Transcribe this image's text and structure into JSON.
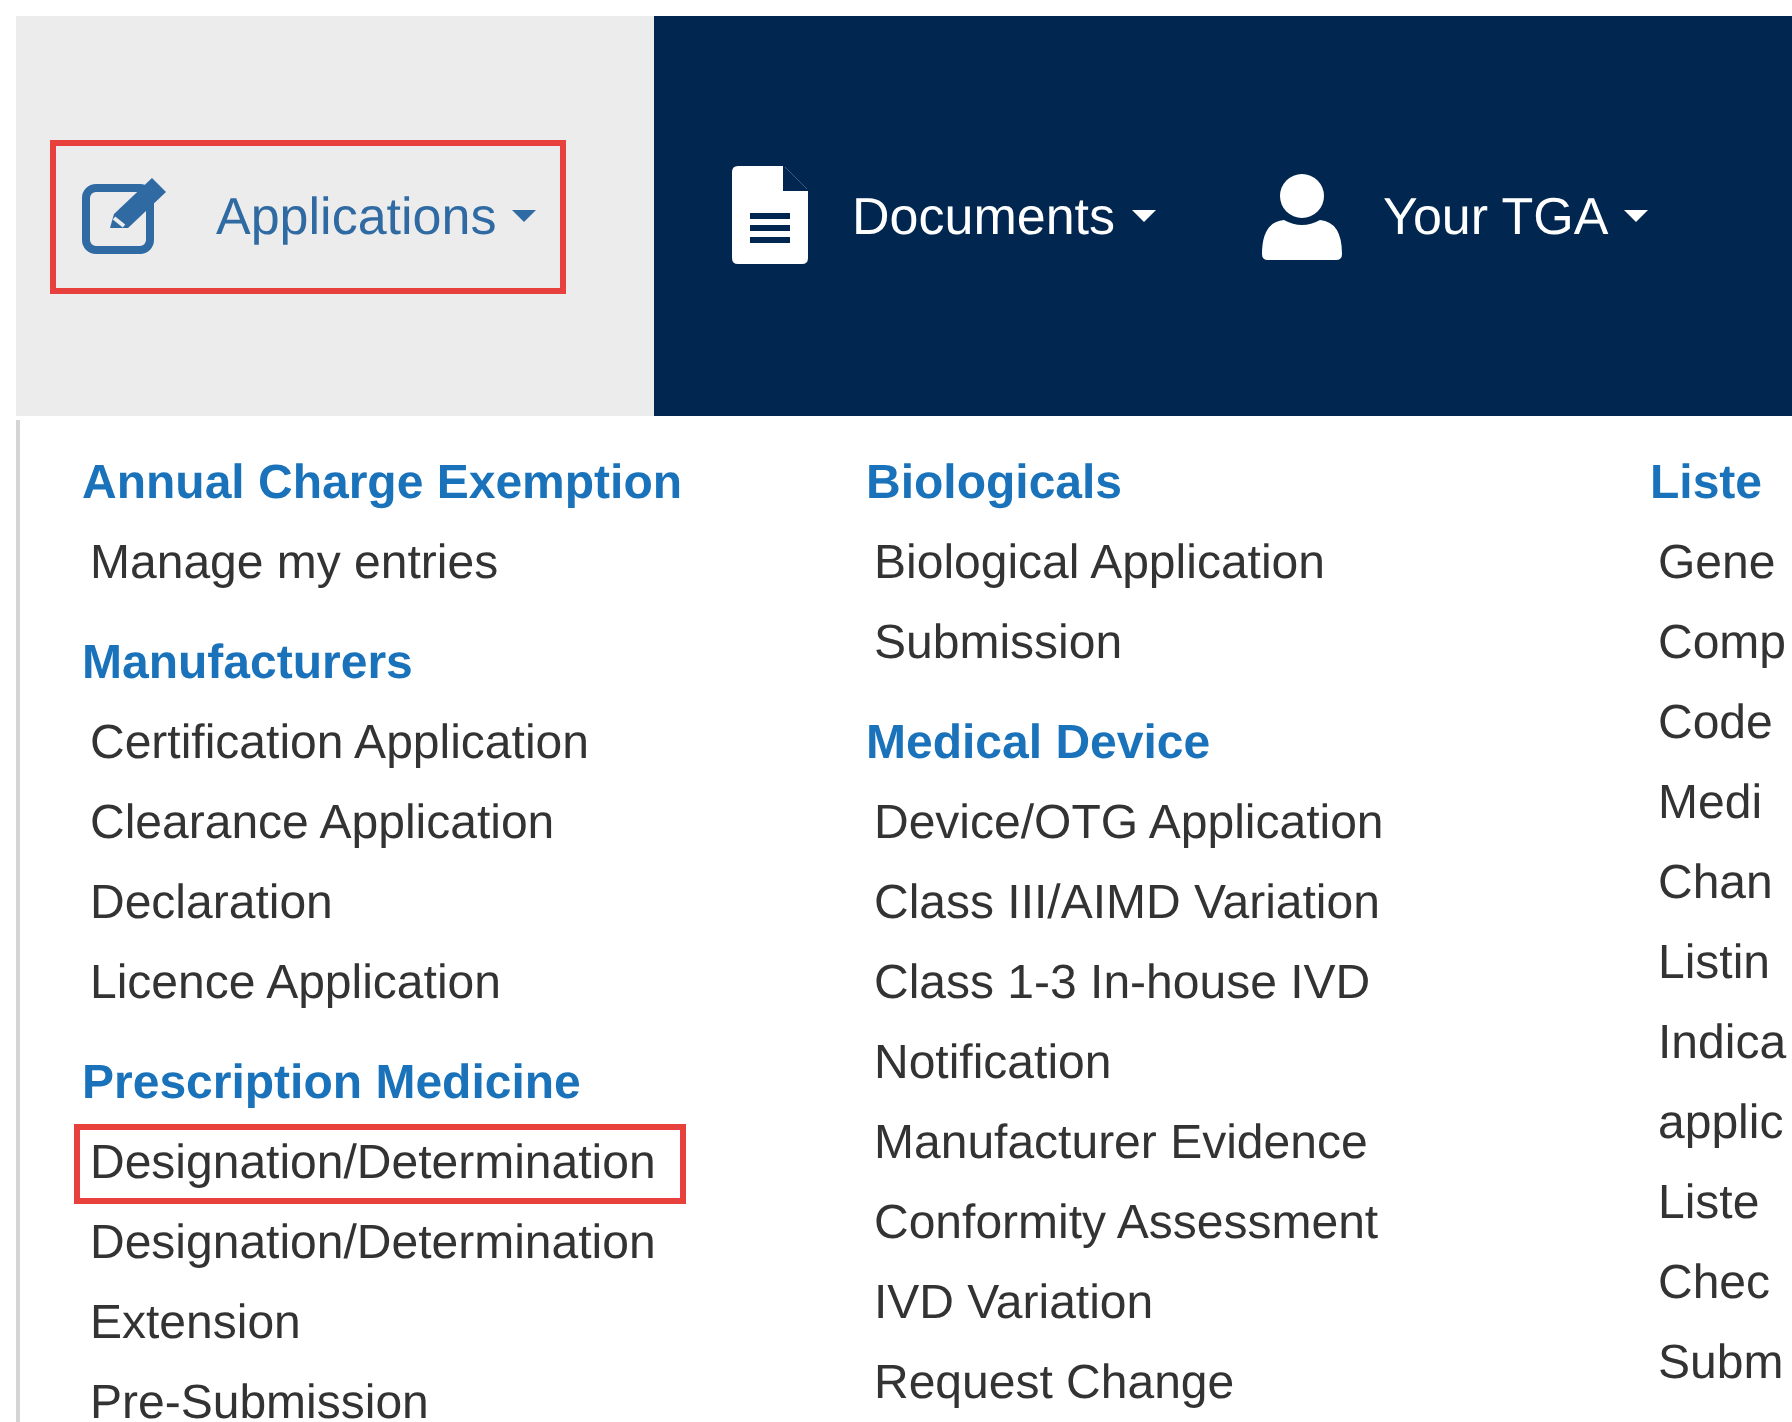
{
  "nav": [
    {
      "label": "Applications",
      "selected": true,
      "highlighted": true
    },
    {
      "label": "Documents",
      "selected": false,
      "highlighted": false
    },
    {
      "label": "Your TGA",
      "selected": false,
      "highlighted": false
    }
  ],
  "menu_columns": [
    {
      "sections": [
        {
          "heading": "Annual Charge Exemption",
          "items": [
            {
              "label": "Manage my entries",
              "highlighted": false
            }
          ]
        },
        {
          "heading": "Manufacturers",
          "items": [
            {
              "label": "Certification Application",
              "highlighted": false
            },
            {
              "label": "Clearance Application",
              "highlighted": false
            },
            {
              "label": "Declaration",
              "highlighted": false
            },
            {
              "label": "Licence Application",
              "highlighted": false
            }
          ]
        },
        {
          "heading": "Prescription Medicine",
          "items": [
            {
              "label": "Designation/Determination",
              "highlighted": true
            },
            {
              "label": "Designation/Determination",
              "highlighted": false
            },
            {
              "label": "Extension",
              "highlighted": false
            },
            {
              "label": "Pre-Submission",
              "highlighted": false
            }
          ]
        }
      ]
    },
    {
      "sections": [
        {
          "heading": "Biologicals",
          "items": [
            {
              "label": "Biological Application",
              "highlighted": false
            },
            {
              "label": "Submission",
              "highlighted": false
            }
          ]
        },
        {
          "heading": "Medical Device",
          "items": [
            {
              "label": "Device/OTG Application",
              "highlighted": false
            },
            {
              "label": "Class III/AIMD Variation",
              "highlighted": false
            },
            {
              "label": "Class 1-3 In-house IVD",
              "highlighted": false
            },
            {
              "label": "Notification",
              "highlighted": false
            },
            {
              "label": "Manufacturer Evidence",
              "highlighted": false
            },
            {
              "label": "Conformity Assessment",
              "highlighted": false
            },
            {
              "label": "IVD Variation",
              "highlighted": false
            },
            {
              "label": "Request Change",
              "highlighted": false
            }
          ]
        }
      ]
    },
    {
      "sections": [
        {
          "heading": "Liste",
          "items": [
            {
              "label": "Gene",
              "highlighted": false
            },
            {
              "label": "Comp",
              "highlighted": false
            },
            {
              "label": "Code",
              "highlighted": false
            },
            {
              "label": "Medi",
              "highlighted": false
            },
            {
              "label": "Chan",
              "highlighted": false
            },
            {
              "label": "Listin",
              "highlighted": false
            },
            {
              "label": "Indica",
              "highlighted": false
            },
            {
              "label": "applic",
              "highlighted": false
            },
            {
              "label": "Liste",
              "highlighted": false
            },
            {
              "label": "Chec",
              "highlighted": false
            },
            {
              "label": "Subm",
              "highlighted": false
            }
          ]
        }
      ]
    }
  ]
}
